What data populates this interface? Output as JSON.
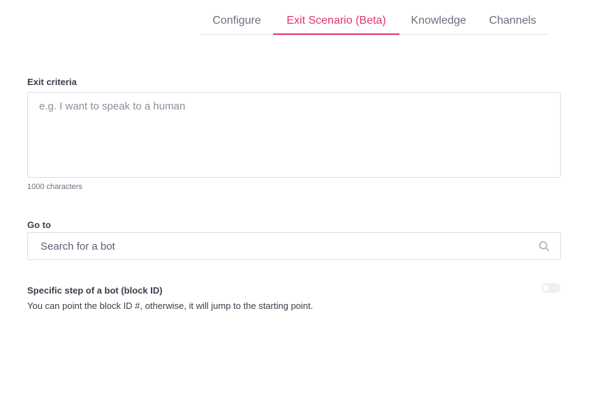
{
  "tabs": [
    {
      "label": "Configure",
      "active": false
    },
    {
      "label": "Exit Scenario (Beta)",
      "active": true
    },
    {
      "label": "Knowledge",
      "active": false
    },
    {
      "label": "Channels",
      "active": false
    }
  ],
  "exit_criteria": {
    "label": "Exit criteria",
    "placeholder": "e.g. I want to speak to a human",
    "value": "",
    "hint": "1000 characters"
  },
  "goto": {
    "label": "Go to",
    "search_placeholder": "Search for a bot",
    "search_value": "",
    "icon": "search-icon"
  },
  "block_id": {
    "label": "Specific step of a bot (block ID)",
    "description": "You can point the block ID #, otherwise, it will jump to the starting point.",
    "toggle_on": false
  },
  "colors": {
    "accent": "#e0336a",
    "tab_inactive": "#6b6f7f",
    "border": "#dcdde3"
  }
}
